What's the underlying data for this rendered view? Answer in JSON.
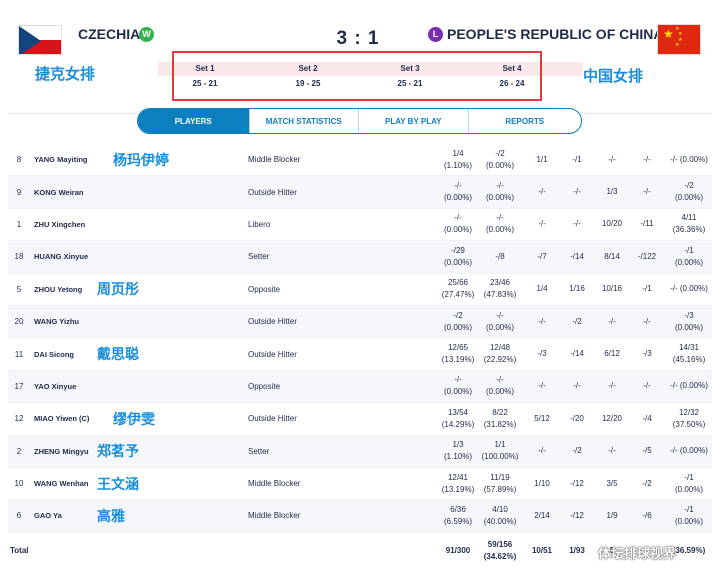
{
  "header": {
    "home_team": "CZECHIA",
    "home_badge": "W",
    "home_cn": "捷克女排",
    "score": "3 : 1",
    "away_team": "PEOPLE'S REPUBLIC OF CHINA",
    "away_badge": "L",
    "away_cn": "中国女排",
    "sets": [
      {
        "label": "Set 1",
        "score": "25 - 21"
      },
      {
        "label": "Set 2",
        "score": "19 - 25"
      },
      {
        "label": "Set 3",
        "score": "25 - 21"
      },
      {
        "label": "Set 4",
        "score": "26 - 24"
      }
    ]
  },
  "tabs": [
    "PLAYERS",
    "MATCH STATISTICS",
    "PLAY BY PLAY",
    "REPORTS"
  ],
  "players": [
    {
      "num": "8",
      "name": "YANG Mayiting",
      "cn": "杨玛伊婷",
      "pos": "Middle Blocker",
      "s": [
        [
          "1/4",
          "(1.10%)"
        ],
        [
          "-/2",
          "(0.00%)"
        ],
        [
          "1/1"
        ],
        [
          "-/1"
        ],
        [
          "-/-"
        ],
        [
          "-/-"
        ],
        [
          "-/- (0.00%)"
        ]
      ]
    },
    {
      "num": "9",
      "name": "KONG Weiran",
      "cn": "",
      "pos": "Outside Hitter",
      "s": [
        [
          "-/-",
          "(0.00%)"
        ],
        [
          "-/-",
          "(0.00%)"
        ],
        [
          "-/-"
        ],
        [
          "-/-"
        ],
        [
          "1/3"
        ],
        [
          "-/-"
        ],
        [
          "-/2",
          "(0.00%)"
        ]
      ]
    },
    {
      "num": "1",
      "name": "ZHU Xingchen",
      "cn": "",
      "pos": "Libero",
      "s": [
        [
          "-/-",
          "(0.00%)"
        ],
        [
          "-/-",
          "(0.00%)"
        ],
        [
          "-/-"
        ],
        [
          "-/-"
        ],
        [
          "10/20"
        ],
        [
          "-/11"
        ],
        [
          "4/11",
          "(36.36%)"
        ]
      ]
    },
    {
      "num": "18",
      "name": "HUANG Xinyue",
      "cn": "",
      "pos": "Setter",
      "s": [
        [
          "-/29",
          "(0.00%)"
        ],
        [
          "-/8"
        ],
        [
          "-/7"
        ],
        [
          "-/14"
        ],
        [
          "8/14"
        ],
        [
          "-/122"
        ],
        [
          "-/1",
          "(0.00%)"
        ]
      ]
    },
    {
      "num": "5",
      "name": "ZHOU Yetong",
      "cn": "周页彤",
      "pos": "Opposite",
      "s": [
        [
          "25/66",
          "(27.47%)"
        ],
        [
          "23/46",
          "(47.83%)"
        ],
        [
          "1/4"
        ],
        [
          "1/16"
        ],
        [
          "10/16"
        ],
        [
          "-/1"
        ],
        [
          "-/- (0.00%)"
        ]
      ]
    },
    {
      "num": "20",
      "name": "WANG Yizhu",
      "cn": "",
      "pos": "Outside Hitter",
      "s": [
        [
          "-/2",
          "(0.00%)"
        ],
        [
          "-/-",
          "(0.00%)"
        ],
        [
          "-/-"
        ],
        [
          "-/2"
        ],
        [
          "-/-"
        ],
        [
          "-/-"
        ],
        [
          "-/3",
          "(0.00%)"
        ]
      ]
    },
    {
      "num": "11",
      "name": "DAI Sicong",
      "cn": "戴思聪",
      "pos": "Outside Hitter",
      "s": [
        [
          "12/65",
          "(13.19%)"
        ],
        [
          "12/48",
          "(22.92%)"
        ],
        [
          "-/3"
        ],
        [
          "-/14"
        ],
        [
          "6/12"
        ],
        [
          "-/3"
        ],
        [
          "14/31",
          "(45.16%)"
        ]
      ]
    },
    {
      "num": "17",
      "name": "YAO Xinyue",
      "cn": "",
      "pos": "Opposite",
      "s": [
        [
          "-/-",
          "(0.00%)"
        ],
        [
          "-/-",
          "(0.00%)"
        ],
        [
          "-/-"
        ],
        [
          "-/-"
        ],
        [
          "-/-"
        ],
        [
          "-/-"
        ],
        [
          "-/- (0.00%)"
        ]
      ]
    },
    {
      "num": "12",
      "name": "MIAO Yiwen (C)",
      "cn": "缪伊雯",
      "pos": "Outside Hitter",
      "s": [
        [
          "13/54",
          "(14.29%)"
        ],
        [
          "8/22",
          "(31.82%)"
        ],
        [
          "5/12"
        ],
        [
          "-/20"
        ],
        [
          "12/20"
        ],
        [
          "-/4"
        ],
        [
          "12/32",
          "(37.50%)"
        ]
      ]
    },
    {
      "num": "2",
      "name": "ZHENG Mingyu",
      "cn": "郑茗予",
      "pos": "Setter",
      "s": [
        [
          "1/3",
          "(1.10%)"
        ],
        [
          "1/1",
          "(100.00%)"
        ],
        [
          "-/-"
        ],
        [
          "-/2"
        ],
        [
          "-/-"
        ],
        [
          "-/5"
        ],
        [
          "-/- (0.00%)"
        ]
      ]
    },
    {
      "num": "10",
      "name": "WANG Wenhan",
      "cn": "王文涵",
      "pos": "Middle Blocker",
      "s": [
        [
          "12/41",
          "(13.19%)"
        ],
        [
          "11/19",
          "(57.89%)"
        ],
        [
          "1/10"
        ],
        [
          "-/12"
        ],
        [
          "3/5"
        ],
        [
          "-/2"
        ],
        [
          "-/1",
          "(0.00%)"
        ]
      ]
    },
    {
      "num": "6",
      "name": "GAO Ya",
      "cn": "高雅",
      "pos": "Middle Blocker",
      "s": [
        [
          "6/36",
          "(6.59%)"
        ],
        [
          "4/10",
          "(40.00%)"
        ],
        [
          "2/14"
        ],
        [
          "-/12"
        ],
        [
          "1/9"
        ],
        [
          "-/6"
        ],
        [
          "-/1",
          "(0.00%)"
        ]
      ]
    }
  ],
  "total": {
    "label": "Total",
    "s": [
      [
        "91/300"
      ],
      [
        "59/156",
        "(34.62%)"
      ],
      [
        "10/51"
      ],
      [
        "1/93"
      ],
      [
        "5"
      ],
      [
        ""
      ],
      [
        "(36.59%)"
      ]
    ]
  },
  "watermark": "体坛排球视界"
}
